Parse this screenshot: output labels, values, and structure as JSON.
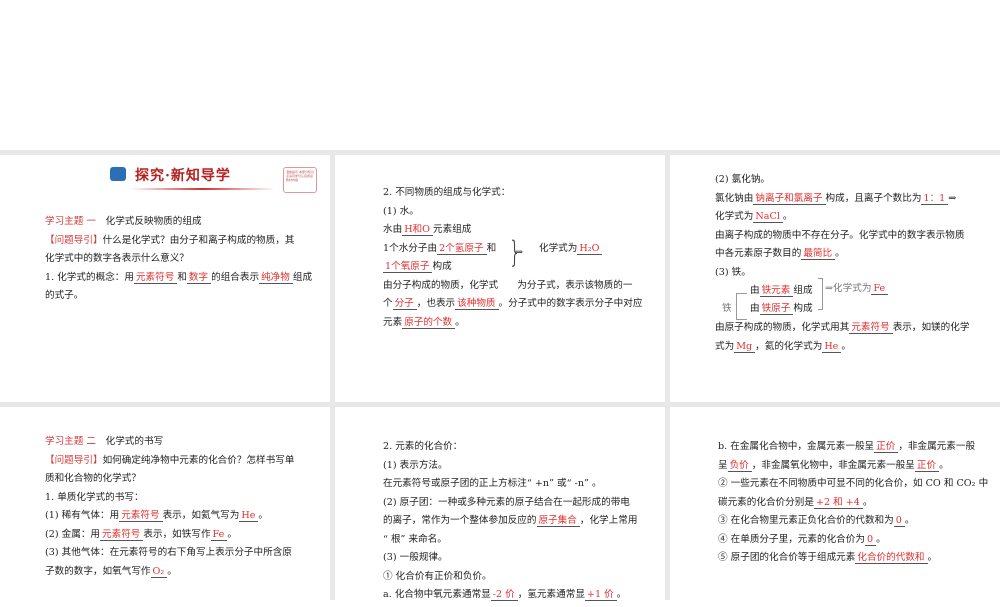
{
  "slides": [
    {
      "banner": "探究·新知导学",
      "note": "温馨提示 本部分知识点请同学们认真阅读教材内容",
      "lines": [
        [
          {
            "t": "学习主题 一",
            "c": "h"
          },
          {
            "t": "　化学式反映物质的组成"
          }
        ],
        [
          {
            "t": "【问题导引】",
            "c": "h"
          },
          {
            "t": "什么是化学式？由分子和离子构成的物质，其"
          }
        ],
        [
          {
            "t": "化学式中的数字各表示什么意义？"
          }
        ],
        [
          {
            "t": "1. 化学式的概念：用"
          },
          {
            "t": "元素符号",
            "c": "r"
          },
          {
            "t": "和"
          },
          {
            "t": "数字",
            "c": "r"
          },
          {
            "t": "的组合表示"
          },
          {
            "t": "纯净物",
            "c": "r"
          },
          {
            "t": "组成"
          }
        ],
        [
          {
            "t": "的式子。"
          }
        ]
      ]
    },
    {
      "lines": [
        [
          {
            "t": "2. 不同物质的组成与化学式："
          }
        ],
        [
          {
            "t": "(1) 水。"
          }
        ],
        [
          {
            "t": "水由"
          },
          {
            "t": "H和O",
            "c": "r"
          },
          {
            "t": "元素组成"
          }
        ],
        [
          {
            "t": "1个水分子由"
          },
          {
            "t": "2个氢原子",
            "c": "r"
          },
          {
            "t": "和"
          }
        ],
        [
          {
            "t": "1个氧原子",
            "c": "r"
          },
          {
            "t": "构成"
          }
        ],
        [
          {
            "t": "由分子构成的物质，化学式　　为分子式，表示该物质的一"
          }
        ],
        [
          {
            "t": "个"
          },
          {
            "t": "分子",
            "c": "r"
          },
          {
            "t": "，也表示"
          },
          {
            "t": "该种物质",
            "c": "r"
          },
          {
            "t": "。分子式中的数字表示分子中对应"
          }
        ],
        [
          {
            "t": "元素"
          },
          {
            "t": "原子的个数",
            "c": "r"
          },
          {
            "t": "。"
          }
        ]
      ],
      "extra": {
        "arrow": "⇒",
        "formula_label": "化学式为",
        "formula": "H₂O"
      }
    },
    {
      "lines": [
        [
          {
            "t": "(2) 氯化钠。"
          }
        ],
        [
          {
            "t": "氯化钠由"
          },
          {
            "t": "钠离子和氯离子",
            "c": "r"
          },
          {
            "t": "构成，且离子个数比为"
          },
          {
            "t": "1：1",
            "c": "r"
          },
          {
            "t": "⇒"
          }
        ],
        [
          {
            "t": "化学式为"
          },
          {
            "t": "NaCl",
            "c": "r"
          },
          {
            "t": "。"
          }
        ],
        [
          {
            "t": "由离子构成的物质中不存在分子。化学式中的数字表示物质"
          }
        ],
        [
          {
            "t": "中各元素原子数目的"
          },
          {
            "t": "最简比",
            "c": "r"
          },
          {
            "t": "。"
          }
        ],
        [
          {
            "t": "(3) 铁。"
          }
        ],
        [
          {
            "t": ""
          }
        ],
        [
          {
            "t": ""
          }
        ],
        [
          {
            "t": "由原子构成的物质，化学式用其"
          },
          {
            "t": "元素符号",
            "c": "r"
          },
          {
            "t": "表示，如镁的化学"
          }
        ],
        [
          {
            "t": "式为"
          },
          {
            "t": "Mg",
            "c": "r"
          },
          {
            "t": "，氦的化学式为"
          },
          {
            "t": "He",
            "c": "r"
          },
          {
            "t": "。"
          }
        ]
      ],
      "extra": {
        "iron": "铁",
        "by1": "由",
        "fill1": "铁元素",
        "suf1": "组成",
        "by2": "由",
        "fill2": "铁原子",
        "suf2": "构成",
        "arrow_label": "⇒化学式为",
        "formula": "Fe"
      }
    },
    {
      "lines": [
        [
          {
            "t": "学习主题 二",
            "c": "h"
          },
          {
            "t": "　化学式的书写"
          }
        ],
        [
          {
            "t": "【问题导引】",
            "c": "h"
          },
          {
            "t": "如何确定纯净物中元素的化合价？怎样书写单"
          }
        ],
        [
          {
            "t": "质和化合物的化学式？"
          }
        ],
        [
          {
            "t": "1. 单质化学式的书写："
          }
        ],
        [
          {
            "t": "(1) 稀有气体：用"
          },
          {
            "t": "元素符号",
            "c": "r"
          },
          {
            "t": "表示，如氦气写为"
          },
          {
            "t": "He",
            "c": "r"
          },
          {
            "t": "。"
          }
        ],
        [
          {
            "t": "(2) 金属：用"
          },
          {
            "t": "元素符号",
            "c": "r"
          },
          {
            "t": "表示，如铁写作"
          },
          {
            "t": "Fe",
            "c": "r"
          },
          {
            "t": "。"
          }
        ],
        [
          {
            "t": "(3) 其他气体：在元素符号的右下角写上表示分子中所含原"
          }
        ],
        [
          {
            "t": "子数的数字，如氧气写作"
          },
          {
            "t": "O₂",
            "c": "r"
          },
          {
            "t": "。"
          }
        ]
      ]
    },
    {
      "lines": [
        [
          {
            "t": "2. 元素的化合价："
          }
        ],
        [
          {
            "t": "(1) 表示方法。"
          }
        ],
        [
          {
            "t": "在元素符号或原子团的正上方标注“ +n” 或“ -n” 。"
          }
        ],
        [
          {
            "t": "(2) 原子团：一种或多种元素的原子结合在一起形成的带电"
          }
        ],
        [
          {
            "t": "的离子，常作为一个整体参加反应的"
          },
          {
            "t": "原子集合",
            "c": "r"
          },
          {
            "t": "，化学上常用"
          }
        ],
        [
          {
            "t": "“ 根” 来命名。"
          }
        ],
        [
          {
            "t": "(3) 一般规律。"
          }
        ],
        [
          {
            "t": "① 化合价有正价和负价。"
          }
        ],
        [
          {
            "t": "a. 化合物中氧元素通常显"
          },
          {
            "t": "-2 价",
            "c": "r"
          },
          {
            "t": "，氢元素通常显"
          },
          {
            "t": "+1 价",
            "c": "r"
          },
          {
            "t": "。"
          }
        ]
      ]
    },
    {
      "lines": [
        [
          {
            "t": "b. 在金属化合物中，金属元素一般呈"
          },
          {
            "t": "正价",
            "c": "r"
          },
          {
            "t": "，非金属元素一般"
          }
        ],
        [
          {
            "t": "呈"
          },
          {
            "t": "负价",
            "c": "r"
          },
          {
            "t": "，非金属氧化物中，非金属元素一般呈"
          },
          {
            "t": "正价",
            "c": "r"
          },
          {
            "t": "。"
          }
        ],
        [
          {
            "t": "② 一些元素在不同物质中可显不同的化合价，如 CO 和 CO₂ 中"
          }
        ],
        [
          {
            "t": "碳元素的化合价分别是"
          },
          {
            "t": "+2 和 +4",
            "c": "r"
          },
          {
            "t": "。"
          }
        ],
        [
          {
            "t": "③ 在化合物里元素正负化合价的代数和为"
          },
          {
            "t": "0",
            "c": "r"
          },
          {
            "t": "。"
          }
        ],
        [
          {
            "t": "④ 在单质分子里，元素的化合价为"
          },
          {
            "t": "0",
            "c": "r"
          },
          {
            "t": "。"
          }
        ],
        [
          {
            "t": "⑤ 原子团的化合价等于组成元素"
          },
          {
            "t": "化合价的代数和",
            "c": "r"
          },
          {
            "t": "。"
          }
        ]
      ]
    }
  ]
}
